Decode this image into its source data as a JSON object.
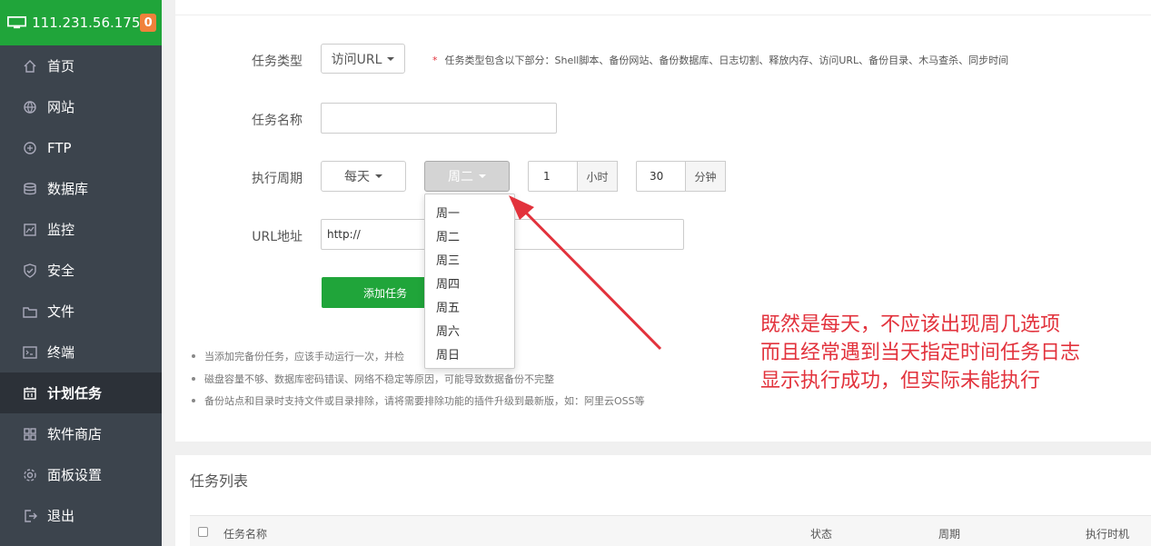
{
  "server": {
    "ip": "111.231.56.175",
    "badge": "0"
  },
  "menu": [
    {
      "label": "首页",
      "icon": "home-icon",
      "active": false
    },
    {
      "label": "网站",
      "icon": "globe-icon",
      "active": false
    },
    {
      "label": "FTP",
      "icon": "ftp-icon",
      "active": false
    },
    {
      "label": "数据库",
      "icon": "database-icon",
      "active": false
    },
    {
      "label": "监控",
      "icon": "monitor-chart-icon",
      "active": false
    },
    {
      "label": "安全",
      "icon": "shield-icon",
      "active": false
    },
    {
      "label": "文件",
      "icon": "folder-icon",
      "active": false
    },
    {
      "label": "终端",
      "icon": "terminal-icon",
      "active": false
    },
    {
      "label": "计划任务",
      "icon": "calendar-icon",
      "active": true
    },
    {
      "label": "软件商店",
      "icon": "apps-grid-icon",
      "active": false
    },
    {
      "label": "面板设置",
      "icon": "gear-icon",
      "active": false
    },
    {
      "label": "退出",
      "icon": "logout-icon",
      "active": false
    }
  ],
  "form": {
    "task_type_label": "任务类型",
    "task_type_value": "访问URL",
    "task_type_hint_star": "*",
    "task_type_hint": "任务类型包含以下部分：Shell脚本、备份网站、备份数据库、日志切割、释放内存、访问URL、备份目录、木马查杀、同步时间",
    "task_name_label": "任务名称",
    "task_name_value": "",
    "period_label": "执行周期",
    "period_value": "每天",
    "weekday_value": "周二",
    "hour_value": "1",
    "hour_unit": "小时",
    "minute_value": "30",
    "minute_unit": "分钟",
    "url_label": "URL地址",
    "url_value": "http://",
    "submit_label": "添加任务"
  },
  "weekday_options": [
    "周一",
    "周二",
    "周三",
    "周四",
    "周五",
    "周六",
    "周日"
  ],
  "tips": [
    "当添加完备份任务，应该手动运行一次，并检",
    "磁盘容量不够、数据库密码错误、网络不稳定等原因，可能导致数据备份不完整",
    "备份站点和目录时支持文件或目录排除，请将需要排除功能的插件升级到最新版，如：阿里云OSS等"
  ],
  "annotation": [
    "既然是每天，不应该出现周几选项",
    "而且经常遇到当天指定时间任务日志",
    "显示执行成功，但实际未能执行"
  ],
  "task_list": {
    "title": "任务列表",
    "columns": [
      "任务名称",
      "状态",
      "周期",
      "执行时机"
    ]
  },
  "colors": {
    "sidebar": "#3c444d",
    "brand_green": "#20a53a",
    "badge": "#f0813b",
    "annotation_red": "#e2323c"
  }
}
